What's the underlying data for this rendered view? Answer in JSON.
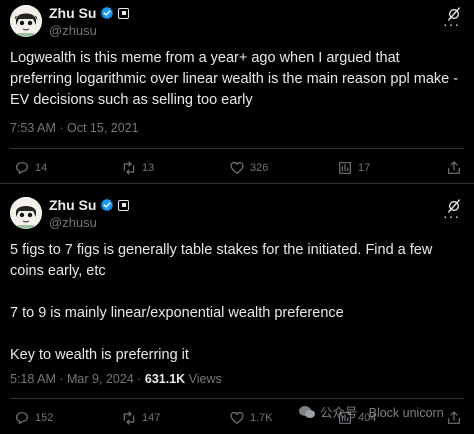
{
  "tweets": [
    {
      "author": {
        "name": "Zhu Su",
        "handle": "@zhusu"
      },
      "text": [
        "Logwealth is this meme from a year+ ago when I argued that preferring logarithmic over linear wealth is the main reason ppl make -EV decisions such as selling too early"
      ],
      "time": "7:53 AM",
      "sep": "·",
      "date": "Oct 15, 2021",
      "stats": {
        "replies": "14",
        "reposts": "13",
        "likes": "326",
        "bookmarks": "17"
      }
    },
    {
      "author": {
        "name": "Zhu Su",
        "handle": "@zhusu"
      },
      "text": [
        "5 figs to 7 figs is generally table stakes for the initiated. Find a few coins early, etc",
        "7 to 9 is mainly linear/exponential wealth preference",
        "Key to wealth is preferring it"
      ],
      "time": "5:18 AM",
      "sep": "·",
      "date": "Mar 9, 2024",
      "views_count": "631.1K",
      "views_label": "Views",
      "stats": {
        "replies": "152",
        "reposts": "147",
        "likes": "1.7K",
        "bookmarks": "404"
      }
    }
  ],
  "watermark": "公众号 · Block unicorn",
  "colors": {
    "verified": "#1d9bf0",
    "text": "#e7e9ea",
    "muted": "#71767b",
    "background": "#000000"
  }
}
